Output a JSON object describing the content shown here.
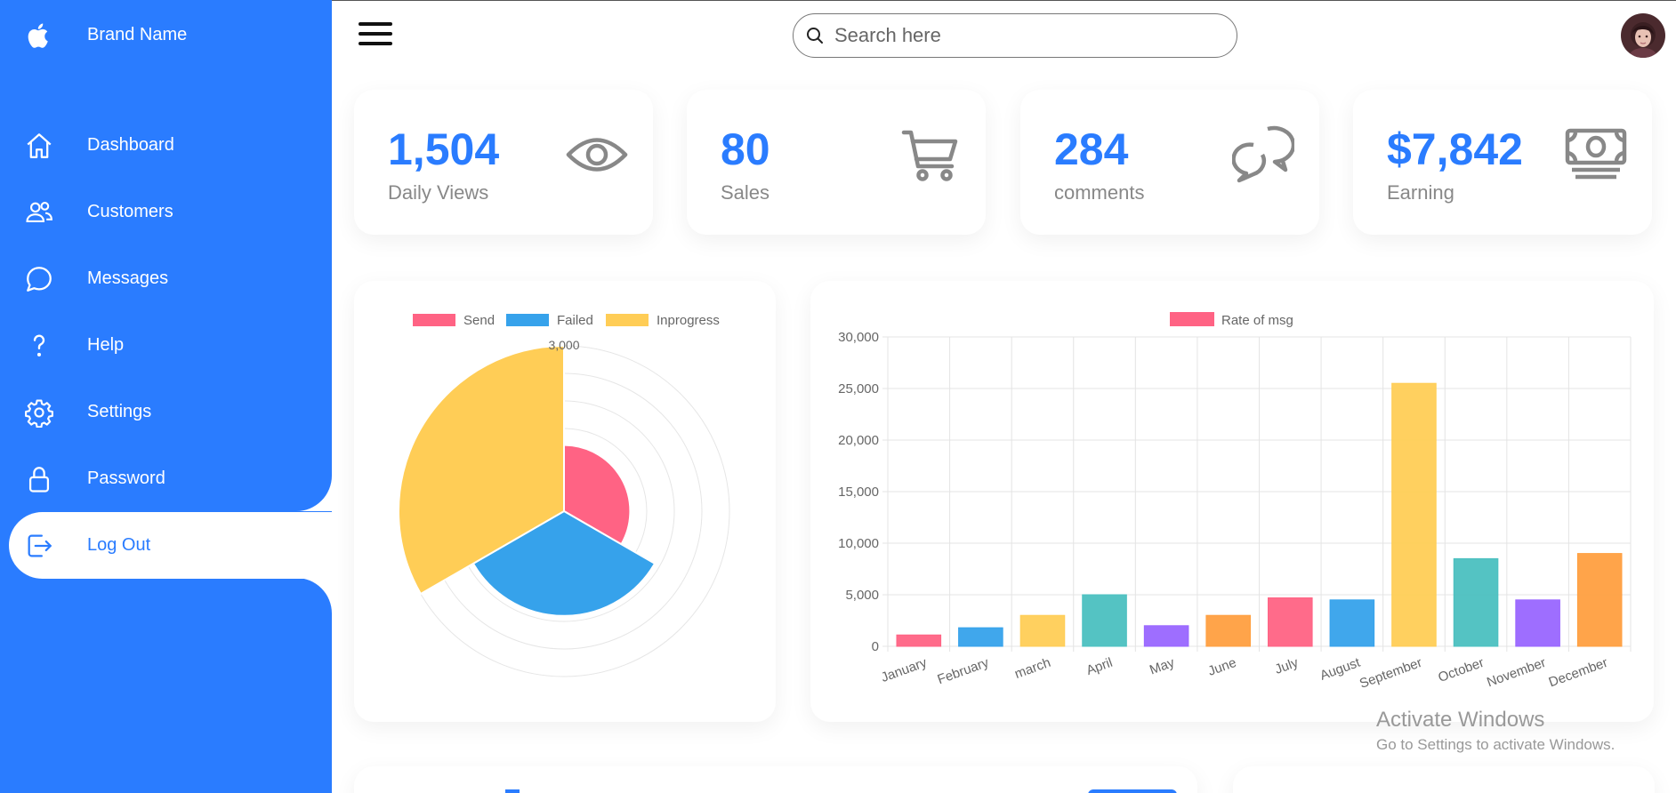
{
  "brand": {
    "name": "Brand Name"
  },
  "sidebar": {
    "items": [
      {
        "label": "Dashboard",
        "icon": "home-icon"
      },
      {
        "label": "Customers",
        "icon": "people-icon"
      },
      {
        "label": "Messages",
        "icon": "chat-icon"
      },
      {
        "label": "Help",
        "icon": "help-icon"
      },
      {
        "label": "Settings",
        "icon": "settings-icon"
      },
      {
        "label": "Password",
        "icon": "lock-icon"
      },
      {
        "label": "Log Out",
        "icon": "logout-icon",
        "active": true
      }
    ]
  },
  "topbar": {
    "search_placeholder": "Search here"
  },
  "cards": [
    {
      "number": "1,504",
      "label": "Daily Views",
      "icon": "eye-icon"
    },
    {
      "number": "80",
      "label": "Sales",
      "icon": "cart-icon"
    },
    {
      "number": "284",
      "label": "comments",
      "icon": "chat-bubbles-icon"
    },
    {
      "number": "$7,842",
      "label": "Earning",
      "icon": "cash-icon"
    }
  ],
  "colors": {
    "brand_blue": "#2a7cff",
    "pink": "#ff6384",
    "blue": "#36a2eb",
    "yellow": "#ffcd56",
    "teal": "#4bc0c0",
    "purple": "#9966ff",
    "orange": "#ff9f40"
  },
  "chart_data": [
    {
      "type": "polarArea",
      "legend": [
        "Send",
        "Failed",
        "Inprogress"
      ],
      "values": [
        1200,
        1900,
        3000
      ],
      "colors": [
        "#ff6384",
        "#36a2eb",
        "#ffcd56"
      ],
      "rlim": [
        0,
        3000
      ],
      "ticks": [
        "3,000"
      ],
      "grid": true,
      "legend_position": "top"
    },
    {
      "type": "bar",
      "legend": [
        "Rate of msg"
      ],
      "categories": [
        "January",
        "February",
        "march",
        "April",
        "May",
        "June",
        "July",
        "August",
        "September",
        "October",
        "November",
        "December"
      ],
      "values": [
        1100,
        1800,
        3000,
        5000,
        2000,
        3000,
        4700,
        4500,
        25500,
        8500,
        4500,
        9000
      ],
      "colors": [
        "#ff6384",
        "#36a2eb",
        "#ffcd56",
        "#4bc0c0",
        "#9966ff",
        "#ff9f40",
        "#ff6384",
        "#36a2eb",
        "#ffcd56",
        "#4bc0c0",
        "#9966ff",
        "#ff9f40"
      ],
      "ylim": [
        0,
        30000
      ],
      "yticks": [
        "0",
        "5,000",
        "10,000",
        "15,000",
        "20,000",
        "25,000",
        "30,000"
      ],
      "grid": true,
      "legend_position": "top"
    }
  ],
  "watermark": {
    "line1": "Activate Windows",
    "line2": "Go to Settings to activate Windows."
  }
}
